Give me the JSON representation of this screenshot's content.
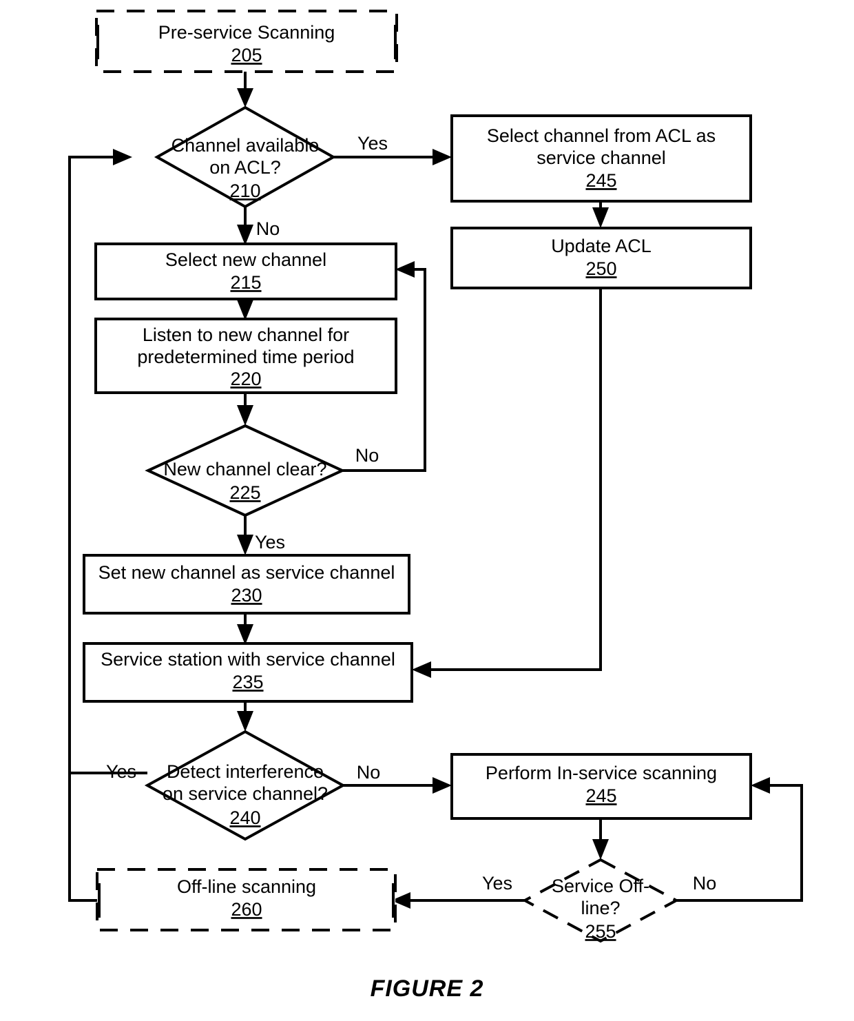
{
  "figure": {
    "caption": "FIGURE 2",
    "title": "Pre-service and In-service channel scanning flowchart"
  },
  "nodes": {
    "n205": {
      "line1": "Pre-service Scanning",
      "ref": "205",
      "style": "dashed-box"
    },
    "n210": {
      "line1": "Channel available",
      "line2": "on ACL?",
      "ref": "210",
      "style": "diamond"
    },
    "n215": {
      "line1": "Select new channel",
      "ref": "215",
      "style": "box"
    },
    "n220": {
      "line1": "Listen to new channel for",
      "line2": "predetermined time period",
      "ref": "220",
      "style": "box"
    },
    "n225": {
      "line1": "New channel clear?",
      "ref": "225",
      "style": "diamond"
    },
    "n230": {
      "line1": "Set new channel as service channel",
      "ref": "230",
      "style": "box"
    },
    "n235": {
      "line1": "Service station with service channel",
      "ref": "235",
      "style": "box"
    },
    "n240": {
      "line1": "Detect interference",
      "line2": "on service channel?",
      "ref": "240",
      "style": "diamond"
    },
    "n245a": {
      "line1": "Select channel from ACL as",
      "line2": "service channel",
      "ref": "245",
      "style": "box"
    },
    "n250": {
      "line1": "Update ACL",
      "ref": "250",
      "style": "box"
    },
    "n245b": {
      "line1": "Perform In-service scanning",
      "ref": "245",
      "style": "box"
    },
    "n255": {
      "line1": "Service Off-",
      "line2": "line?",
      "ref": "255",
      "style": "dashed-diamond"
    },
    "n260": {
      "line1": "Off-line scanning",
      "ref": "260",
      "style": "dashed-box"
    }
  },
  "edge_labels": {
    "e210_yes": "Yes",
    "e210_no": "No",
    "e225_no": "No",
    "e225_yes": "Yes",
    "e240_yes": "Yes",
    "e240_no": "No",
    "e255_yes": "Yes",
    "e255_no": "No"
  },
  "colors": {
    "stroke": "#000000",
    "fill": "#ffffff",
    "background": "#ffffff"
  }
}
